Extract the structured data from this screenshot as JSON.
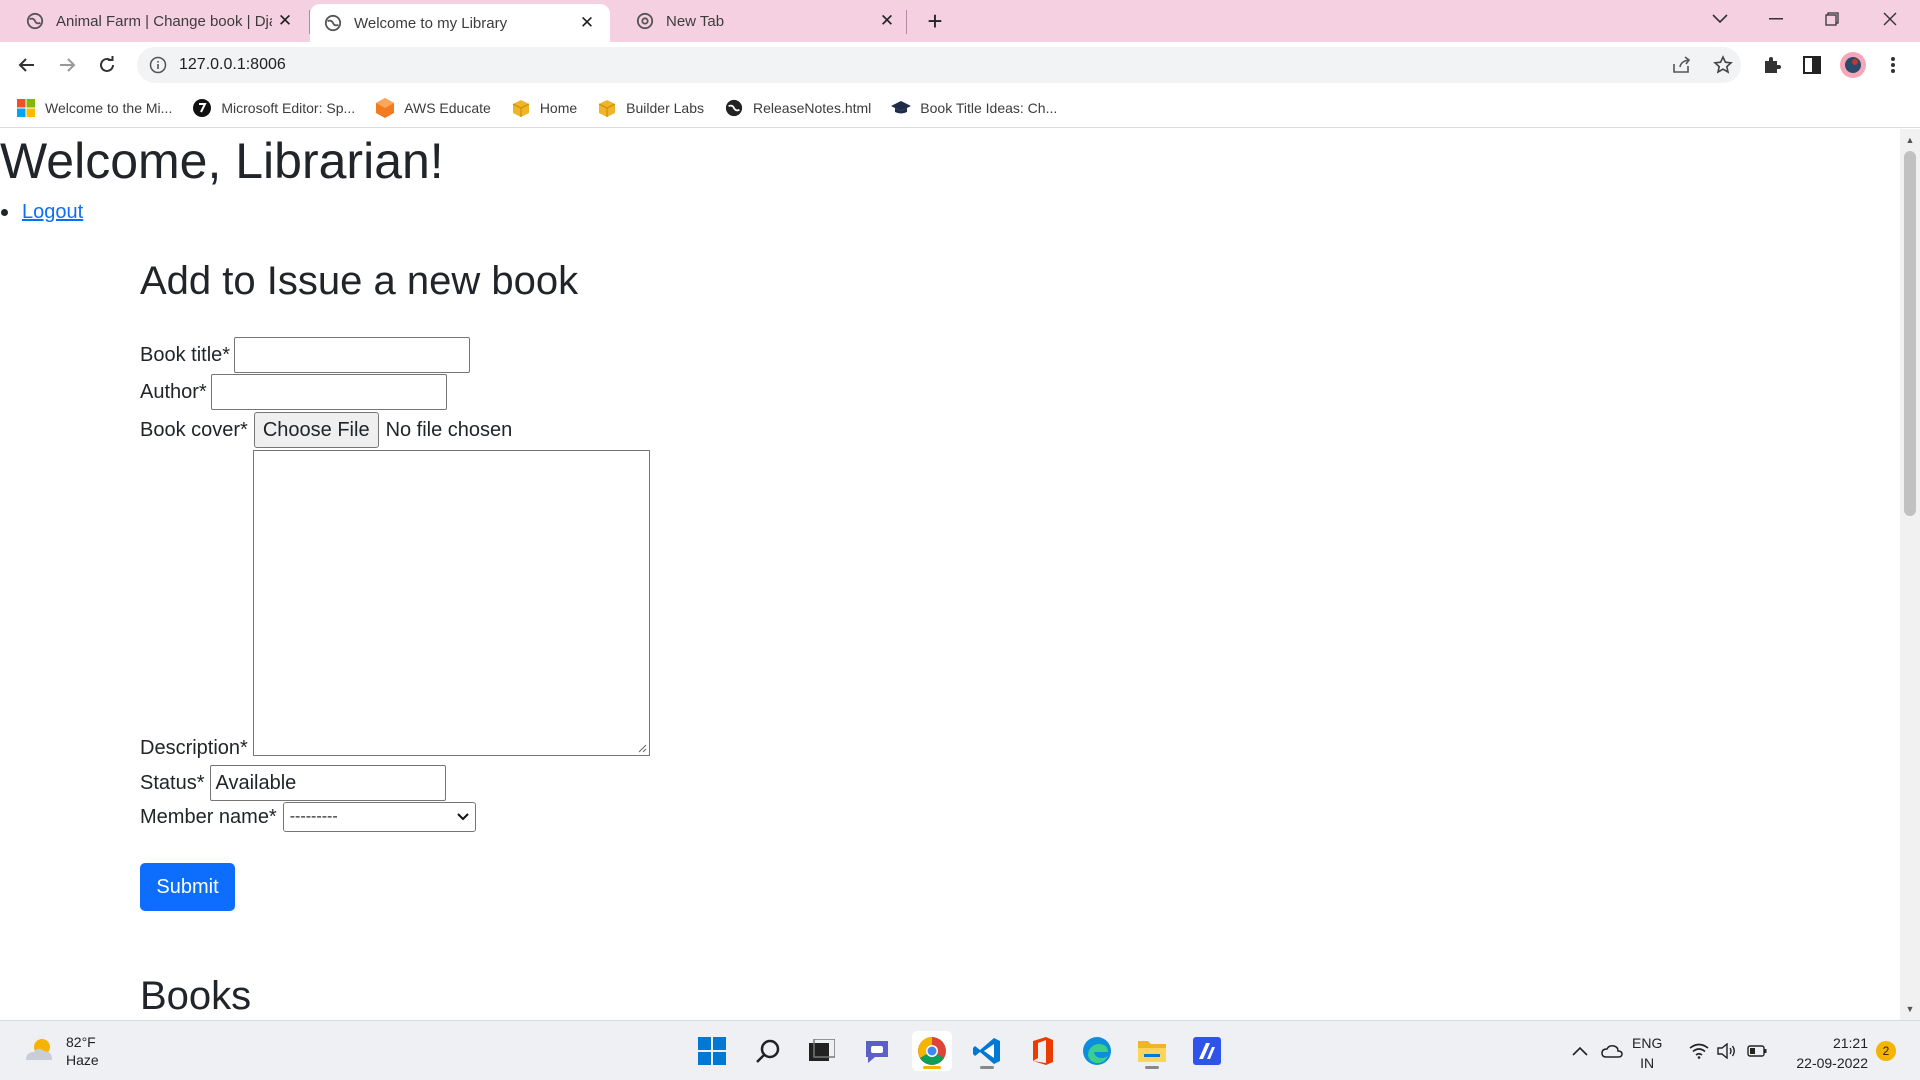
{
  "browser": {
    "tabs": [
      {
        "title": "Animal Farm | Change book | Dja",
        "close": "✕",
        "active": false
      },
      {
        "title": "Welcome to my Library",
        "close": "✕",
        "active": true
      },
      {
        "title": "New Tab",
        "close": "✕",
        "active": false
      }
    ],
    "new_tab": "+",
    "url": "127.0.0.1:8006",
    "bookmarks": [
      {
        "label": "Welcome to the Mi...",
        "icon": "microsoft-icon"
      },
      {
        "label": "Microsoft Editor: Sp...",
        "icon": "editor-icon"
      },
      {
        "label": "AWS Educate",
        "icon": "aws-icon"
      },
      {
        "label": "Home",
        "icon": "box-icon"
      },
      {
        "label": "Builder Labs",
        "icon": "box-icon"
      },
      {
        "label": "ReleaseNotes.html",
        "icon": "globe-icon"
      },
      {
        "label": "Book Title Ideas: Ch...",
        "icon": "graduation-cap-icon"
      }
    ]
  },
  "page": {
    "title": "Welcome, Librarian!",
    "logout": "Logout",
    "form": {
      "heading": "Add to Issue a new book",
      "book_title_label": "Book title*",
      "book_title_value": "",
      "author_label": "Author*",
      "author_value": "",
      "book_cover_label": "Book cover*",
      "choose_file": "Choose File",
      "no_file": "No file chosen",
      "description_label": "Description*",
      "status_label": "Status*",
      "status_value": "Available",
      "member_label": "Member name*",
      "member_selected": "---------",
      "submit": "Submit"
    },
    "books_heading": "Books"
  },
  "taskbar": {
    "weather_temp": "82°F",
    "weather_cond": "Haze",
    "lang_top": "ENG",
    "lang_bottom": "IN",
    "time": "21:21",
    "date": "22-09-2022",
    "notifications": "2"
  },
  "colors": {
    "tabstrip": "#f5d0e0",
    "primary_button": "#0d6efd",
    "link": "#0d6efd"
  }
}
